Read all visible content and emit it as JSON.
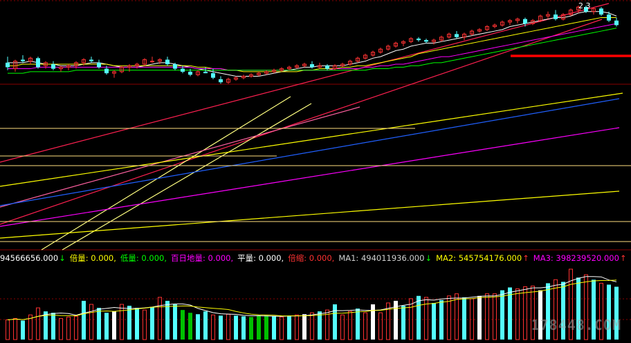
{
  "app": "stock-kline-terminal",
  "colors": {
    "background": "#000000",
    "up": "#ff3232",
    "down": "#54ffff",
    "white_bar": "#ffffff",
    "green_bar": "#00c000",
    "grid": "#8a0000",
    "ma_white": "#ffffff",
    "ma_yellow": "#ffff00",
    "ma_magenta": "#ff00ff",
    "ma_green": "#00ff00",
    "ma_blue": "#2060ff",
    "tl_red": "#ff2050",
    "tl_yellow": "#ffff80",
    "tl_pink": "#ff60a0",
    "hline": "#ffe080",
    "support": "#ff0000"
  },
  "top_label": "2.3",
  "legend": [
    {
      "text": "94566656.000",
      "color": "#ffffff",
      "arrow": "↓",
      "arrow_color": "#00ff00"
    },
    {
      "text": "倍量: 0.000,",
      "color": "#ffff00"
    },
    {
      "text": "低量: 0.000,",
      "color": "#00ff00"
    },
    {
      "text": "百日地量: 0.000,",
      "color": "#ff00ff"
    },
    {
      "text": "平量: 0.000,",
      "color": "#ffffff"
    },
    {
      "text": "倍缩: 0.000,",
      "color": "#ff3232"
    },
    {
      "text": "MA1: 494011936.000",
      "color": "#d0d0d0",
      "arrow": "↓",
      "arrow_color": "#00ff00"
    },
    {
      "text": "MA2: 545754176.000",
      "color": "#ffff00",
      "arrow": "↑",
      "arrow_color": "#ff3232"
    },
    {
      "text": "MA3: 398239520.000",
      "color": "#ff00ff",
      "arrow": "↑",
      "arrow_color": "#ff3232"
    }
  ],
  "watermark": "178448.COM",
  "chart_data": [
    {
      "type": "candlestick",
      "panel": "price",
      "title": "",
      "ylim": [
        0,
        100
      ],
      "candles": [
        {
          "o": 62,
          "h": 66,
          "l": 57,
          "c": 59
        },
        {
          "o": 58,
          "h": 64,
          "l": 56,
          "c": 63
        },
        {
          "o": 64,
          "h": 67,
          "l": 62,
          "c": 63
        },
        {
          "o": 63,
          "h": 66,
          "l": 61,
          "c": 65
        },
        {
          "o": 65,
          "h": 66,
          "l": 58,
          "c": 59
        },
        {
          "o": 60,
          "h": 63,
          "l": 58,
          "c": 62
        },
        {
          "o": 61,
          "h": 63,
          "l": 57,
          "c": 58
        },
        {
          "o": 58,
          "h": 60,
          "l": 56,
          "c": 59
        },
        {
          "o": 59,
          "h": 61,
          "l": 57,
          "c": 60
        },
        {
          "o": 60,
          "h": 63,
          "l": 58,
          "c": 62
        },
        {
          "o": 62,
          "h": 65,
          "l": 60,
          "c": 64
        },
        {
          "o": 64,
          "h": 66,
          "l": 62,
          "c": 63
        },
        {
          "o": 62,
          "h": 64,
          "l": 58,
          "c": 59
        },
        {
          "o": 58,
          "h": 60,
          "l": 54,
          "c": 55
        },
        {
          "o": 55,
          "h": 57,
          "l": 52,
          "c": 56
        },
        {
          "o": 56,
          "h": 60,
          "l": 55,
          "c": 59
        },
        {
          "o": 59,
          "h": 61,
          "l": 56,
          "c": 60
        },
        {
          "o": 60,
          "h": 62,
          "l": 58,
          "c": 61
        },
        {
          "o": 61,
          "h": 65,
          "l": 60,
          "c": 64
        },
        {
          "o": 63,
          "h": 66,
          "l": 62,
          "c": 63
        },
        {
          "o": 63,
          "h": 65,
          "l": 61,
          "c": 64
        },
        {
          "o": 64,
          "h": 66,
          "l": 60,
          "c": 61
        },
        {
          "o": 61,
          "h": 62,
          "l": 57,
          "c": 58
        },
        {
          "o": 58,
          "h": 60,
          "l": 55,
          "c": 56
        },
        {
          "o": 56,
          "h": 58,
          "l": 53,
          "c": 54
        },
        {
          "o": 54,
          "h": 57,
          "l": 53,
          "c": 56
        },
        {
          "o": 56,
          "h": 59,
          "l": 55,
          "c": 55
        },
        {
          "o": 55,
          "h": 58,
          "l": 51,
          "c": 52
        },
        {
          "o": 51,
          "h": 53,
          "l": 48,
          "c": 49
        },
        {
          "o": 49,
          "h": 52,
          "l": 48,
          "c": 51
        },
        {
          "o": 51,
          "h": 53,
          "l": 50,
          "c": 52
        },
        {
          "o": 52,
          "h": 54,
          "l": 51,
          "c": 53
        },
        {
          "o": 53,
          "h": 55,
          "l": 52,
          "c": 54
        },
        {
          "o": 54,
          "h": 56,
          "l": 53,
          "c": 55
        },
        {
          "o": 55,
          "h": 57,
          "l": 54,
          "c": 56
        },
        {
          "o": 56,
          "h": 58,
          "l": 55,
          "c": 57
        },
        {
          "o": 57,
          "h": 59,
          "l": 56,
          "c": 58
        },
        {
          "o": 58,
          "h": 60,
          "l": 57,
          "c": 59
        },
        {
          "o": 59,
          "h": 61,
          "l": 58,
          "c": 60
        },
        {
          "o": 60,
          "h": 62,
          "l": 59,
          "c": 61
        },
        {
          "o": 61,
          "h": 63,
          "l": 58,
          "c": 59
        },
        {
          "o": 59,
          "h": 62,
          "l": 58,
          "c": 60
        },
        {
          "o": 60,
          "h": 61,
          "l": 57,
          "c": 58
        },
        {
          "o": 58,
          "h": 61,
          "l": 57,
          "c": 60
        },
        {
          "o": 60,
          "h": 62,
          "l": 59,
          "c": 61
        },
        {
          "o": 61,
          "h": 64,
          "l": 60,
          "c": 63
        },
        {
          "o": 63,
          "h": 66,
          "l": 62,
          "c": 65
        },
        {
          "o": 65,
          "h": 68,
          "l": 64,
          "c": 67
        },
        {
          "o": 67,
          "h": 70,
          "l": 66,
          "c": 69
        },
        {
          "o": 69,
          "h": 72,
          "l": 68,
          "c": 71
        },
        {
          "o": 71,
          "h": 74,
          "l": 70,
          "c": 73
        },
        {
          "o": 73,
          "h": 76,
          "l": 72,
          "c": 75
        },
        {
          "o": 75,
          "h": 77,
          "l": 73,
          "c": 76
        },
        {
          "o": 76,
          "h": 79,
          "l": 75,
          "c": 78
        },
        {
          "o": 78,
          "h": 79,
          "l": 76,
          "c": 77
        },
        {
          "o": 77,
          "h": 78,
          "l": 75,
          "c": 76
        },
        {
          "o": 76,
          "h": 78,
          "l": 74,
          "c": 77
        },
        {
          "o": 77,
          "h": 80,
          "l": 76,
          "c": 79
        },
        {
          "o": 79,
          "h": 82,
          "l": 78,
          "c": 81
        },
        {
          "o": 81,
          "h": 83,
          "l": 78,
          "c": 79
        },
        {
          "o": 79,
          "h": 82,
          "l": 77,
          "c": 81
        },
        {
          "o": 81,
          "h": 84,
          "l": 80,
          "c": 83
        },
        {
          "o": 83,
          "h": 85,
          "l": 82,
          "c": 84
        },
        {
          "o": 84,
          "h": 87,
          "l": 83,
          "c": 86
        },
        {
          "o": 86,
          "h": 88,
          "l": 85,
          "c": 87
        },
        {
          "o": 87,
          "h": 90,
          "l": 86,
          "c": 89
        },
        {
          "o": 89,
          "h": 91,
          "l": 87,
          "c": 90
        },
        {
          "o": 90,
          "h": 92,
          "l": 88,
          "c": 91
        },
        {
          "o": 91,
          "h": 92,
          "l": 86,
          "c": 88
        },
        {
          "o": 88,
          "h": 91,
          "l": 87,
          "c": 90
        },
        {
          "o": 90,
          "h": 94,
          "l": 89,
          "c": 93
        },
        {
          "o": 93,
          "h": 96,
          "l": 91,
          "c": 94
        },
        {
          "o": 94,
          "h": 97,
          "l": 90,
          "c": 91
        },
        {
          "o": 91,
          "h": 95,
          "l": 90,
          "c": 94
        },
        {
          "o": 94,
          "h": 98,
          "l": 93,
          "c": 97
        },
        {
          "o": 97,
          "h": 100,
          "l": 95,
          "c": 99
        },
        {
          "o": 99,
          "h": 100,
          "l": 95,
          "c": 96
        },
        {
          "o": 96,
          "h": 99,
          "l": 94,
          "c": 98
        },
        {
          "o": 98,
          "h": 99,
          "l": 93,
          "c": 94
        },
        {
          "o": 94,
          "h": 96,
          "l": 89,
          "c": 90
        },
        {
          "o": 90,
          "h": 92,
          "l": 86,
          "c": 87
        }
      ],
      "moving_averages": [
        {
          "color": "#ffffff",
          "values": [
            62,
            62,
            62,
            63,
            62,
            61,
            61,
            60,
            60,
            60,
            61,
            62,
            62,
            61,
            60,
            59,
            59,
            59,
            60,
            61,
            62,
            62,
            61,
            60,
            59,
            58,
            57,
            56,
            55,
            54,
            53,
            53,
            53,
            53,
            54,
            55,
            56,
            57,
            58,
            59,
            59,
            60,
            60,
            60,
            60,
            61,
            62,
            63,
            65,
            66,
            68,
            70,
            71,
            73,
            74,
            75,
            75,
            76,
            77,
            78,
            79,
            80,
            81,
            82,
            83,
            84,
            86,
            87,
            88,
            89,
            90,
            91,
            92,
            92,
            93,
            95,
            96,
            96,
            96,
            95,
            93
          ]
        },
        {
          "color": "#ffff00",
          "values": [
            60,
            60,
            61,
            61,
            61,
            61,
            61,
            61,
            61,
            61,
            61,
            61,
            61,
            61,
            60,
            60,
            60,
            60,
            60,
            60,
            60,
            60,
            60,
            60,
            60,
            59,
            59,
            58,
            58,
            57,
            57,
            56,
            56,
            56,
            56,
            56,
            56,
            56,
            56,
            57,
            57,
            58,
            58,
            58,
            59,
            59,
            60,
            60,
            61,
            62,
            63,
            64,
            65,
            66,
            68,
            69,
            70,
            71,
            72,
            73,
            74,
            75,
            76,
            77,
            78,
            79,
            80,
            81,
            82,
            83,
            84,
            85,
            86,
            87,
            88,
            89,
            90,
            91,
            92,
            92,
            92
          ]
        },
        {
          "color": "#ff00ff",
          "values": [
            58,
            58,
            58,
            58,
            59,
            59,
            59,
            59,
            59,
            59,
            59,
            59,
            59,
            59,
            59,
            59,
            59,
            59,
            59,
            59,
            59,
            59,
            59,
            59,
            59,
            58,
            58,
            58,
            58,
            57,
            57,
            57,
            57,
            57,
            57,
            57,
            57,
            57,
            57,
            57,
            57,
            57,
            57,
            58,
            58,
            58,
            58,
            59,
            59,
            60,
            60,
            61,
            61,
            62,
            63,
            64,
            65,
            66,
            66,
            67,
            68,
            69,
            70,
            71,
            72,
            73,
            74,
            75,
            76,
            77,
            78,
            79,
            80,
            81,
            82,
            83,
            84,
            85,
            86,
            87,
            88
          ]
        },
        {
          "color": "#00ff00",
          "values": [
            55,
            55,
            55,
            56,
            56,
            56,
            56,
            56,
            56,
            57,
            57,
            57,
            57,
            57,
            57,
            57,
            57,
            57,
            57,
            57,
            57,
            57,
            57,
            57,
            57,
            57,
            57,
            57,
            57,
            57,
            57,
            57,
            57,
            57,
            57,
            57,
            57,
            57,
            57,
            57,
            57,
            57,
            57,
            57,
            57,
            57,
            57,
            57,
            58,
            58,
            58,
            59,
            59,
            60,
            60,
            61,
            62,
            62,
            63,
            64,
            65,
            66,
            67,
            68,
            69,
            70,
            71,
            72,
            73,
            74,
            75,
            76,
            77,
            78,
            79,
            80,
            81,
            82,
            83,
            84,
            85
          ]
        }
      ]
    },
    {
      "type": "bar",
      "panel": "volume",
      "title": "",
      "ylim": [
        0,
        100
      ],
      "values": [
        28,
        30,
        27,
        35,
        45,
        40,
        38,
        30,
        32,
        33,
        55,
        50,
        45,
        38,
        40,
        50,
        48,
        45,
        42,
        46,
        60,
        55,
        50,
        42,
        38,
        36,
        40,
        35,
        34,
        36,
        34,
        33,
        32,
        34,
        34,
        33,
        32,
        34,
        35,
        36,
        38,
        40,
        42,
        50,
        35,
        40,
        44,
        38,
        50,
        38,
        52,
        55,
        48,
        58,
        62,
        60,
        52,
        56,
        62,
        65,
        60,
        58,
        62,
        65,
        65,
        70,
        74,
        72,
        75,
        76,
        70,
        80,
        85,
        82,
        100,
        88,
        92,
        85,
        80,
        78,
        75
      ],
      "kinds": [
        "up",
        "up",
        "down",
        "up",
        "up",
        "down",
        "down",
        "up",
        "up",
        "up",
        "down",
        "up",
        "down",
        "down",
        "white",
        "up",
        "down",
        "down",
        "up",
        "down",
        "up",
        "down",
        "down",
        "green",
        "green",
        "down",
        "down",
        "up",
        "down",
        "up",
        "down",
        "down",
        "green",
        "green",
        "green",
        "down",
        "up",
        "down",
        "up",
        "white",
        "up",
        "down",
        "up",
        "down",
        "up",
        "up",
        "down",
        "up",
        "white",
        "up",
        "up",
        "white",
        "down",
        "up",
        "down",
        "up",
        "down",
        "down",
        "up",
        "up",
        "down",
        "up",
        "white",
        "up",
        "up",
        "down",
        "down",
        "up",
        "up",
        "up",
        "white",
        "down",
        "up",
        "down",
        "up",
        "down",
        "up",
        "down",
        "up",
        "down",
        "down"
      ]
    }
  ]
}
